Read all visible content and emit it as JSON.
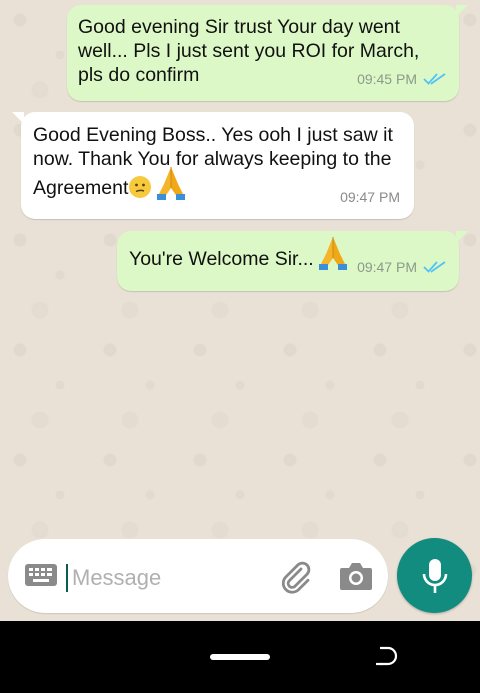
{
  "messages": [
    {
      "direction": "outgoing",
      "lines": [
        "Good evening Sir trust Your day went",
        "well... Pls I just sent you ROI for March,",
        "pls do confirm"
      ],
      "time": "09:45 PM",
      "status": "read"
    },
    {
      "direction": "incoming",
      "lines": [
        "Good Evening Boss.. Yes ooh I just saw it",
        "now. Thank You for always keeping to the",
        "Agreement"
      ],
      "emojis": [
        "slightly-frowning-face-icon",
        "folded-hands-icon"
      ],
      "time": "09:47 PM"
    },
    {
      "direction": "outgoing",
      "lines": [
        "You're Welcome Sir..."
      ],
      "emojis": [
        "folded-hands-icon"
      ],
      "time": "09:47 PM",
      "status": "read"
    }
  ],
  "composer": {
    "placeholder": "Message",
    "value": ""
  },
  "icons": {
    "keyboard": "keyboard-icon",
    "attach": "paperclip-icon",
    "camera": "camera-icon",
    "mic": "microphone-icon",
    "read_receipt": "double-check-icon",
    "nav_back": "back-icon"
  },
  "colors": {
    "outgoing_bubble": "#dcf8c6",
    "incoming_bubble": "#ffffff",
    "accent": "#128c7e",
    "read_tick": "#4fc3f7"
  }
}
